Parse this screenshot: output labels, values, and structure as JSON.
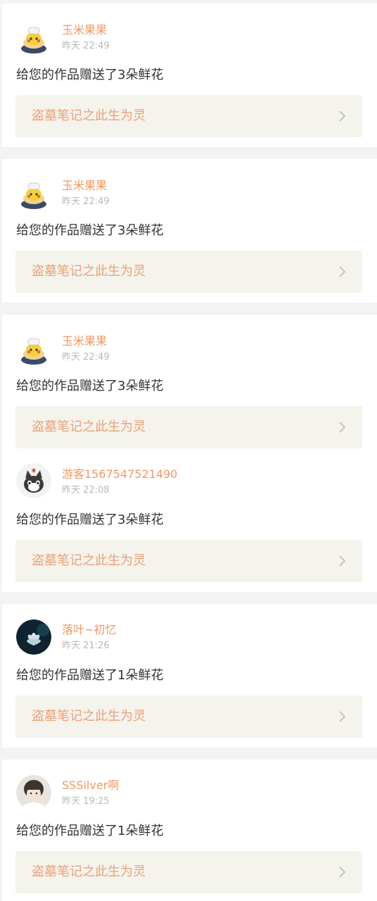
{
  "notifications": [
    {
      "username": "玉米果果",
      "time": "昨天 22:49",
      "message": "给您的作品赠送了3朵鲜花",
      "work_title": "盗墓笔记之此生为灵",
      "avatar_icon": "pikachu-chef-icon"
    },
    {
      "username": "玉米果果",
      "time": "昨天 22:49",
      "message": "给您的作品赠送了3朵鲜花",
      "work_title": "盗墓笔记之此生为灵",
      "avatar_icon": "pikachu-chef-icon"
    },
    {
      "username": "玉米果果",
      "time": "昨天 22:49",
      "message": "给您的作品赠送了3朵鲜花",
      "work_title": "盗墓笔记之此生为灵",
      "avatar_icon": "pikachu-chef-icon"
    },
    {
      "username": "游客1567547521490",
      "time": "昨天 22:08",
      "message": "给您的作品赠送了3朵鲜花",
      "work_title": "盗墓笔记之此生为灵",
      "avatar_icon": "cat-face-icon"
    },
    {
      "username": "落叶~初忆",
      "time": "昨天 21:26",
      "message": "给您的作品赠送了1朵鲜花",
      "work_title": "盗墓笔记之此生为灵",
      "avatar_icon": "lotus-flower-icon"
    },
    {
      "username": "SSSilver啊",
      "time": "昨天 19:25",
      "message": "给您的作品赠送了1朵鲜花",
      "work_title": "盗墓笔记之此生为灵",
      "avatar_icon": "person-photo-icon"
    }
  ],
  "colors": {
    "username": "#ee9966",
    "time": "#b9b9b9",
    "message": "#333333",
    "work_title": "#e8a27a",
    "link_background": "#f4f3ec",
    "page_background": "#f3f3f3"
  }
}
